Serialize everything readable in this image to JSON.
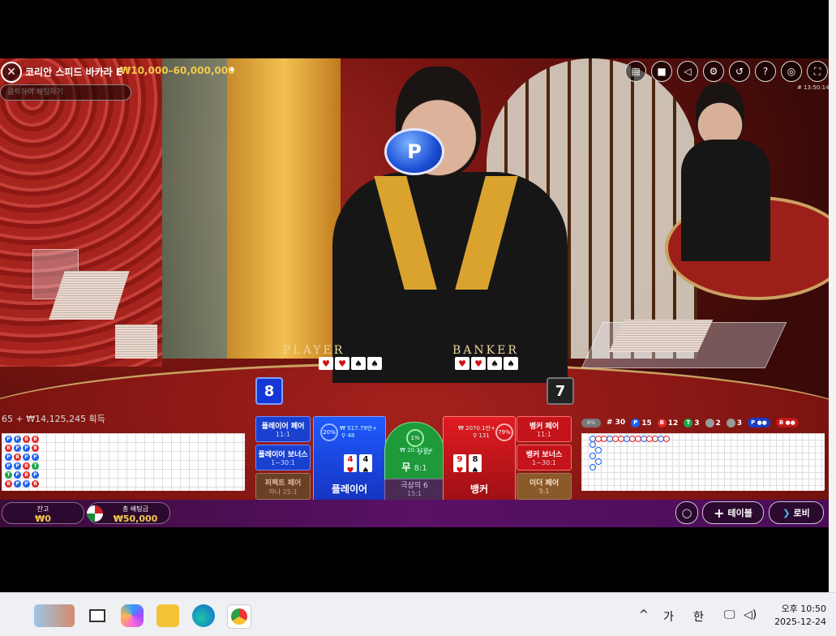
{
  "header": {
    "title": "코리안 스피드 바카라 E",
    "limits": "₩10,000–60,000,000",
    "chat_placeholder": "클릭하여 채팅하기",
    "round_id": "# 13:50:14"
  },
  "tools": [
    "chat-icon",
    "video-icon",
    "sound-icon",
    "settings-icon",
    "history-icon",
    "help-icon",
    "fullscreen-exit-icon",
    "fullscreen-icon"
  ],
  "table": {
    "player_label": "PLAYER",
    "banker_label": "BANKER",
    "badge": "P",
    "player_score": "8",
    "banker_score": "7",
    "player_cards": [
      {
        "r": "4",
        "s": "♥",
        "red": true
      },
      {
        "r": "4",
        "s": "♠",
        "red": false
      }
    ],
    "banker_cards": [
      {
        "r": "9",
        "s": "♥",
        "red": true
      },
      {
        "r": "8",
        "s": "♠",
        "red": false
      }
    ]
  },
  "ticker": "65 + ₩14,125,245 획득",
  "side_bets": {
    "player_pair": {
      "label": "플레이어 페어",
      "odds": "11:1"
    },
    "player_bonus": {
      "label": "플레이어 보너스",
      "odds": "1~30:1"
    },
    "perfect_pair": {
      "label": "퍼펙트 페어",
      "odds": "하나 25:1"
    },
    "banker_pair": {
      "label": "뱅커 페어",
      "odds": "11:1"
    },
    "banker_bonus": {
      "label": "뱅커 보너스",
      "odds": "1~30:1"
    },
    "either_pair": {
      "label": "이더 페어",
      "odds": "5:1"
    }
  },
  "main_bets": {
    "player": {
      "label": "플레이어",
      "pct": "20%",
      "amount": "₩ 517.79만+",
      "players": "48"
    },
    "banker": {
      "label": "뱅커",
      "pct": "79%",
      "amount": "₩ 2070.1만+",
      "players": "131"
    },
    "tie": {
      "label": "무",
      "odds": "8:1",
      "pct": "1%",
      "amount": "₩ 20.31만+",
      "players": "22"
    },
    "super6": {
      "label": "극상의 6",
      "odds": "15:1"
    }
  },
  "stats": {
    "total": "# 30",
    "player": "15",
    "banker": "12",
    "tie": "3",
    "player_pair": "2",
    "banker_pair": "3",
    "toggle": "0%",
    "p_pill": "P",
    "b_pill": "B"
  },
  "bottom": {
    "balance_label": "잔고",
    "balance_value": "₩0",
    "totalbet_label": "총 배팅금",
    "totalbet_value": "₩50,000",
    "table_btn": "테이블",
    "lobby_btn": "로비"
  },
  "taskbar": {
    "ime1": "가",
    "ime2": "한",
    "time": "오후 10:50",
    "date": "2025-12-24"
  }
}
